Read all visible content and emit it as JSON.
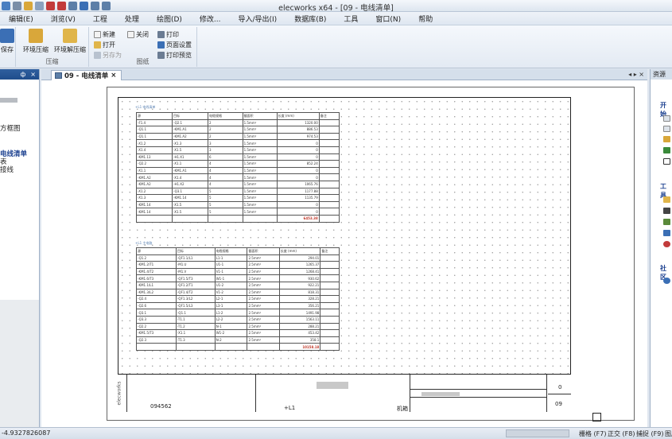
{
  "window": {
    "title": "elecworks x64 - [09 - 电线清单]"
  },
  "menu": [
    "编辑(E)",
    "浏览(V)",
    "工程",
    "处理",
    "绘图(D)",
    "修改...",
    "导入/导出(I)",
    "数据库(B)",
    "工具",
    "窗口(N)",
    "帮助"
  ],
  "ribbon": {
    "save_label": "保存",
    "compress_label": "环境压缩",
    "decompress_label": "环境解压缩",
    "compress_group": "压缩",
    "new_label": "新建",
    "open_label": "打开",
    "saveas_label": "另存为",
    "close_label": "关闭",
    "drawing_group": "图纸",
    "print_label": "打印",
    "page_setup_label": "页面设置",
    "print_preview_label": "打印预览"
  },
  "left_panel": {
    "items": [
      "方框图",
      "电线清单",
      "表",
      "接线"
    ]
  },
  "doc_tab": {
    "label": "09 - 电线清单",
    "close": "×"
  },
  "drawing": {
    "table1": {
      "label": "+L1 电线清单",
      "headers": [
        "源",
        "目标",
        "电缆规格",
        "截面积",
        "长度 (mm)",
        "备注"
      ],
      "rows": [
        [
          "-F1.4",
          "-Q2.1",
          "2",
          "1.5mm²",
          "1320.00",
          ""
        ],
        [
          "-Q1.1",
          "-KM1.A1",
          "2",
          "1.5mm²",
          "886.53",
          ""
        ],
        [
          "-Q1.1",
          "-KM1.A2",
          "2",
          "1.5mm²",
          "974.53",
          ""
        ],
        [
          "-X1.2",
          "-X1.3",
          "3",
          "1.5mm²",
          "0",
          ""
        ],
        [
          "-X1.4",
          "-X1.5",
          "3",
          "1.5mm²",
          "0",
          ""
        ],
        [
          "-KM1.13",
          "-H1.X1",
          "6",
          "1.5mm²",
          "0",
          ""
        ],
        [
          "-Q2.2",
          "-X1.1",
          "4",
          "1.5mm²",
          "852.24",
          ""
        ],
        [
          "-X1.1",
          "-KM1.A1",
          "4",
          "1.5mm²",
          "0",
          ""
        ],
        [
          "-KM1.A2",
          "-X1.4",
          "4",
          "1.5mm²",
          "0",
          ""
        ],
        [
          "-KM1.A2",
          "-H1.X2",
          "4",
          "1.5mm²",
          "1065.76",
          ""
        ],
        [
          "-X1.2",
          "-Q3.1",
          "5",
          "1.5mm²",
          "1177.88",
          ""
        ],
        [
          "-X1.3",
          "-KM1.14",
          "5",
          "1.5mm²",
          "1135.79",
          ""
        ],
        [
          "-KM1.14",
          "-X1.5",
          "5",
          "1.5mm²",
          "0",
          ""
        ],
        [
          "-KM1.14",
          "-X1.5",
          "5",
          "1.5mm²",
          "0",
          ""
        ]
      ],
      "total": "6453.38"
    },
    "table2": {
      "label": "+L1 主电路",
      "headers": [
        "源",
        "目标",
        "电缆规格",
        "截面积",
        "长度 (mm)",
        "备注"
      ],
      "rows": [
        [
          "-Q1.2",
          "-QF1.1/L1",
          "L1-1",
          "2.5mm²",
          "294.01",
          ""
        ],
        [
          "-KM1.2/T1",
          "-M1.U",
          "U1-1",
          "2.5mm²",
          "1265.37",
          ""
        ],
        [
          "-KM1.4/T2",
          "-M1.V",
          "V1-1",
          "2.5mm²",
          "1268.41",
          ""
        ],
        [
          "-KM1.6/T3",
          "-QF1.5/T3",
          "W1-1",
          "2.5mm²",
          "930.62",
          ""
        ],
        [
          "-KM1.1/L1",
          "-QF1.2/T1",
          "U1-2",
          "2.5mm²",
          "922.21",
          ""
        ],
        [
          "-KM1.3/L2",
          "-QF1.4/T2",
          "V1-2",
          "2.5mm²",
          "818.31",
          ""
        ],
        [
          "-Q2.4",
          "-QF1.3/L2",
          "L2-1",
          "2.5mm²",
          "328.21",
          ""
        ],
        [
          "-Q2.6",
          "-QF1.5/L3",
          "L3-1",
          "2.5mm²",
          "356.21",
          ""
        ],
        [
          "-Q3.1",
          "-Q1.1",
          "L1-2",
          "2.5mm²",
          "1491.98",
          ""
        ],
        [
          "-Q3.3",
          "-T1.1",
          "L2-2",
          "2.5mm²",
          "1563.11",
          ""
        ],
        [
          "-Q2.2",
          "-T1.2",
          "N-1",
          "2.5mm²",
          "288.21",
          ""
        ],
        [
          "-KM1.5/T3",
          "-X1.1",
          "W1-2",
          "2.5mm²",
          "453.42",
          ""
        ],
        [
          "-Q2.3",
          "-T1.3",
          "N-2",
          "2.5mm²",
          "358.1",
          ""
        ]
      ],
      "total": "10158.18"
    },
    "titleblock": {
      "logo": "elecworks",
      "drawing_no": "094562",
      "location": "+L1",
      "cabinet": "机箱",
      "revision": "0",
      "sheet": "09"
    }
  },
  "right_panel": {
    "header": "资源",
    "sections": [
      "开始",
      "工具",
      "社区"
    ]
  },
  "status": {
    "coords": "-4.9327826087",
    "buttons": [
      "栅格 (F7)",
      "正交 (F8)",
      "捕捉 (F9)",
      "图层"
    ]
  }
}
